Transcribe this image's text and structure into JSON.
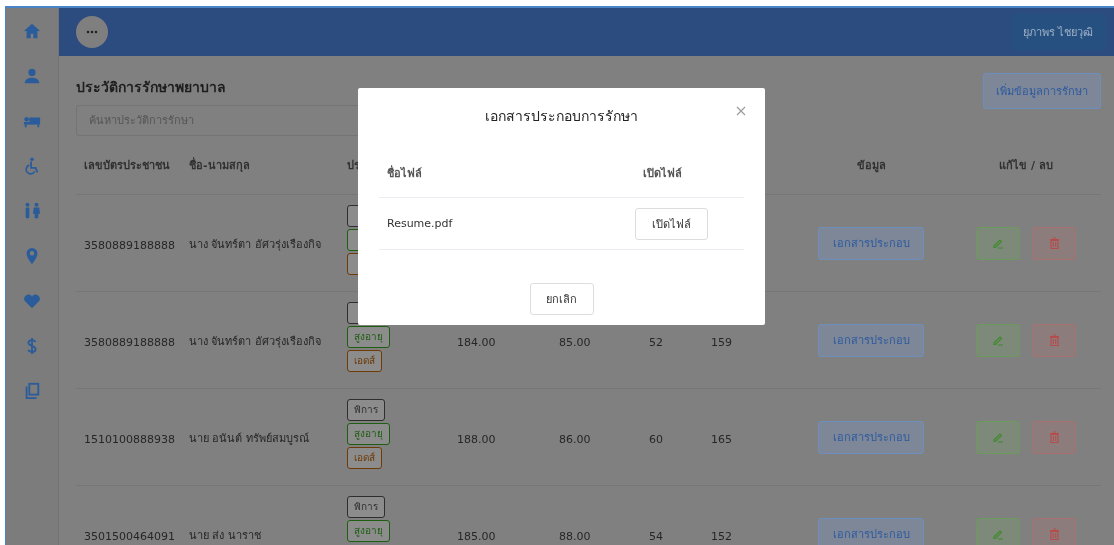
{
  "header": {
    "user_button": "ยุภาพร ไชยวุฒิ"
  },
  "page": {
    "title": "ประวัติการรักษาพยาบาล",
    "add_button": "เพิ่มข้อมูลการรักษา",
    "search": {
      "placeholder": "ค้นหาประวัติการรักษา"
    }
  },
  "table": {
    "columns": {
      "id": "เลขบัตรประชาชน",
      "name": "ชื่อ-นามสกุล",
      "column_3": "ปร",
      "info": "ข้อมูล",
      "actions": "แก้ไข / ลบ"
    },
    "rows": [
      {
        "id": "3580889188888",
        "name": "นาง จันทร์ตา อัศวรุ่งเรืองกิจ",
        "tags": [
          {
            "color": "#2e2e2e"
          },
          {
            "color": "#1d5e10"
          },
          {
            "color": "#6e3a06"
          }
        ],
        "info_button": "เอกสารประกอบ"
      },
      {
        "id": "3580889188888",
        "name": "นาง จันทร์ตา อัศวรุ่งเรืองกิจ",
        "tags": [
          {
            "color": "#2e2e2e"
          },
          {
            "label": "สูงอายุ",
            "color": "#1d5e10"
          },
          {
            "label": "เอดส์",
            "color": "#6e3a06"
          }
        ],
        "column_4": "184.00",
        "column_5": "85.00",
        "column_6": "52",
        "column_7": "159",
        "info_button": "เอกสารประกอบ"
      },
      {
        "id": "1510100888938",
        "name": "นาย อนันต์ ทรัพย์สมบูรณ์",
        "tags": [
          {
            "label": "พิการ",
            "color": "#2e2e2e"
          },
          {
            "label": "สูงอายุ",
            "color": "#1d5e10"
          },
          {
            "label": "เอดส์",
            "color": "#6e3a06"
          }
        ],
        "column_4": "188.00",
        "column_5": "86.00",
        "column_6": "60",
        "column_7": "165",
        "info_button": "เอกสารประกอบ"
      },
      {
        "id": "3501500464091",
        "name": "นาย ส่ง นาราช",
        "tags": [
          {
            "label": "พิการ",
            "color": "#2e2e2e"
          },
          {
            "label": "สูงอายุ",
            "color": "#1d5e10"
          }
        ],
        "column_4": "185.00",
        "column_5": "88.00",
        "column_6": "54",
        "column_7": "152",
        "info_button": "เอกสารประกอบ"
      }
    ]
  },
  "modal": {
    "title": "เอกสารประกอบการรักษา",
    "columns": [
      "ชื่อไฟล์",
      "เปิดไฟล์"
    ],
    "files": [
      {
        "name": "Resume.pdf",
        "open_button": "เปิดไฟล์"
      }
    ],
    "cancel_button": "ยกเลิก"
  }
}
